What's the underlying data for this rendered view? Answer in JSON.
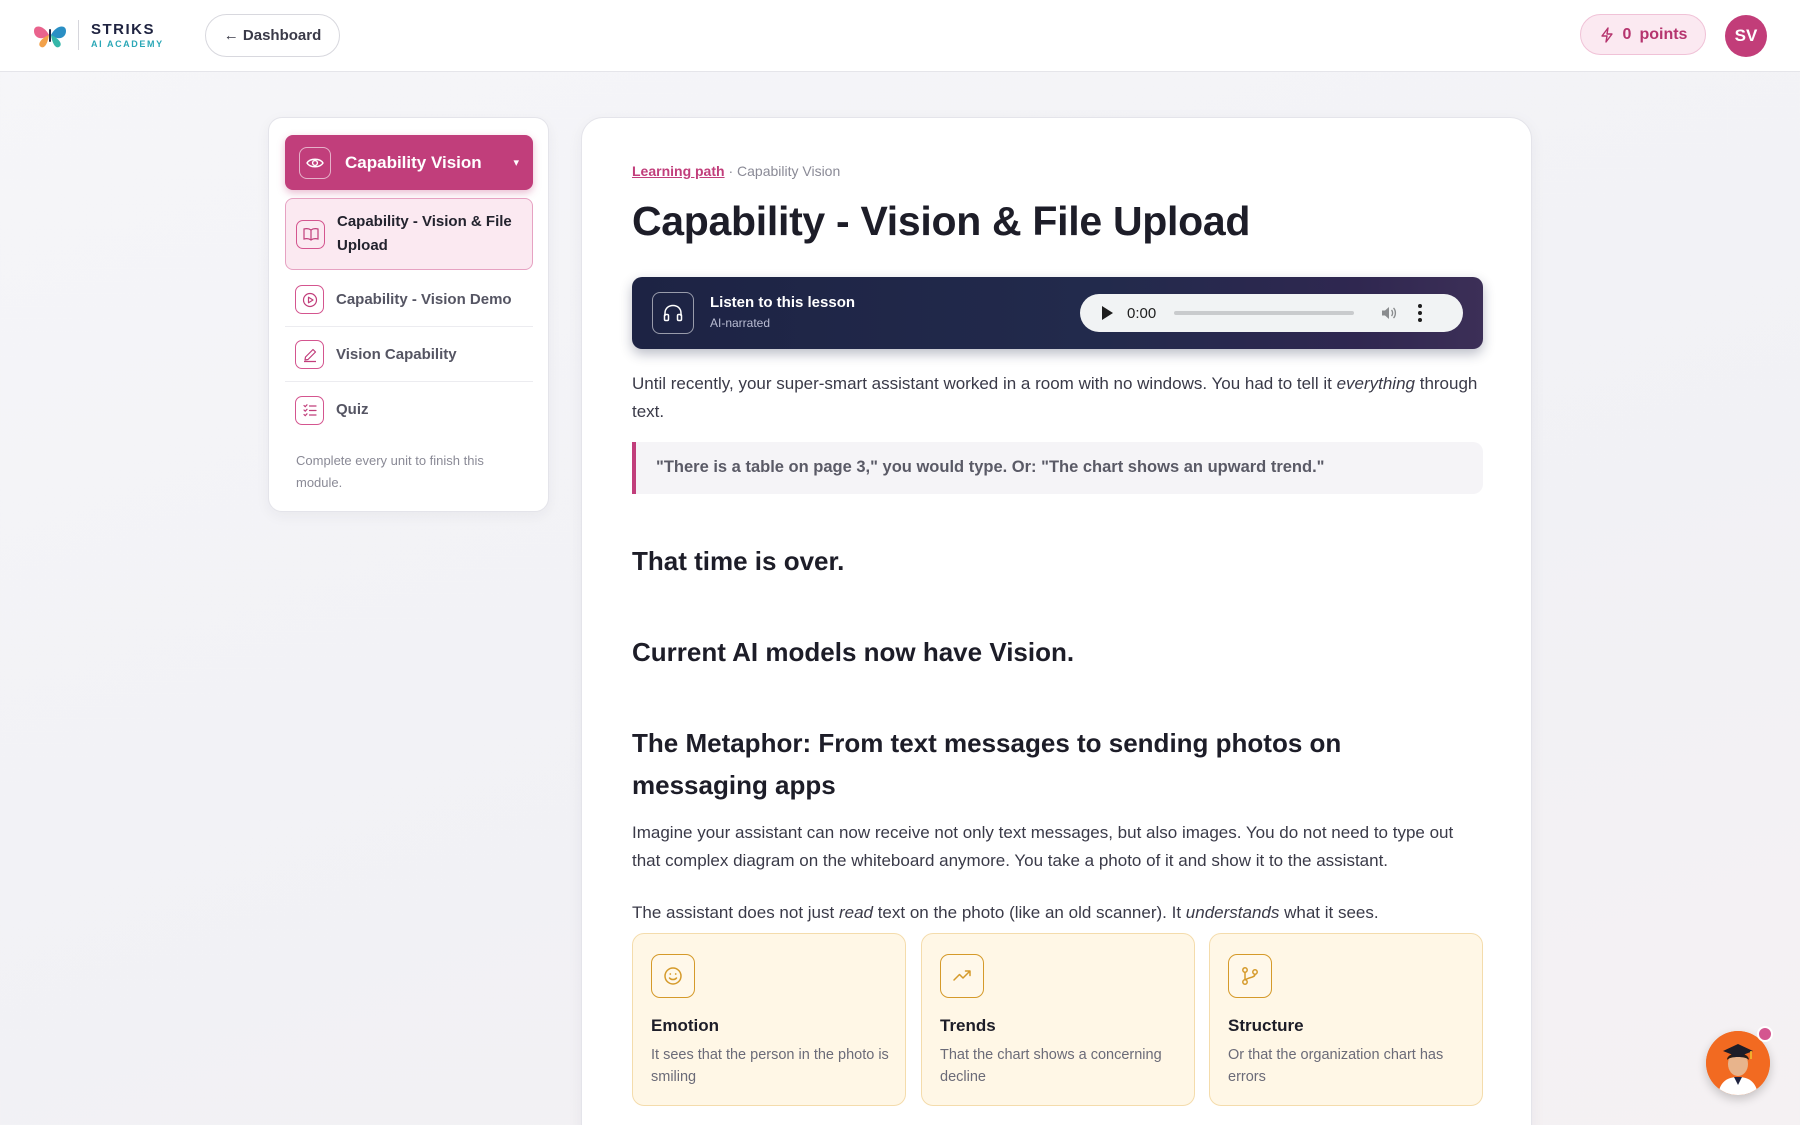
{
  "header": {
    "brand_name": "STRIKS",
    "brand_sub": "AI ACADEMY",
    "back_label": "← Dashboard",
    "points_value": "0",
    "points_label": "points",
    "avatar_initials": "SV"
  },
  "sidebar": {
    "module_title": "Capability Vision",
    "units": [
      {
        "label": "Capability - Vision & File Upload",
        "icon": "book-icon",
        "active": true
      },
      {
        "label": "Capability - Vision Demo",
        "icon": "play-circle-icon",
        "active": false
      },
      {
        "label": "Vision Capability",
        "icon": "pencil-icon",
        "active": false
      },
      {
        "label": "Quiz",
        "icon": "checklist-icon",
        "active": false
      }
    ],
    "note": "Complete every unit to finish this module."
  },
  "lesson": {
    "breadcrumb_link": "Learning path",
    "breadcrumb_sep": " · ",
    "breadcrumb_current": "Capability Vision",
    "title": "Capability - Vision & File Upload",
    "audio": {
      "title": "Listen to this lesson",
      "subtitle": "AI-narrated",
      "time": "0:00"
    },
    "intro_a": "Until recently, your super-smart assistant worked in a room with no windows. You had to tell it ",
    "intro_em": "everything",
    "intro_b": " through text.",
    "quote": "\"There is a table on page 3,\" you would type. Or: \"The chart shows an upward trend.\"",
    "heading1": "That time is over.",
    "heading2": "Current AI models now have Vision.",
    "heading3": "The Metaphor: From text messages to sending photos on messaging apps",
    "para2": "Imagine your assistant can now receive not only text messages, but also images. You do not need to type out that complex diagram on the whiteboard anymore. You take a photo of it and show it to the assistant.",
    "para3_a": "The assistant does not just ",
    "para3_em1": "read",
    "para3_b": " text on the photo (like an old scanner). It ",
    "para3_em2": "understands",
    "para3_c": " what it sees.",
    "features": [
      {
        "title": "Emotion",
        "desc": "It sees that the person in the photo is smiling",
        "icon": "smile-icon"
      },
      {
        "title": "Trends",
        "desc": "That the chart shows a concerning decline",
        "icon": "trend-up-icon"
      },
      {
        "title": "Structure",
        "desc": "Or that the organization chart has errors",
        "icon": "branch-icon"
      }
    ]
  },
  "colors": {
    "accent": "#c13e7b",
    "audio_bg": "#1d2344",
    "feature_bg": "#fff7e6",
    "feature_icon": "#d59a2a"
  }
}
